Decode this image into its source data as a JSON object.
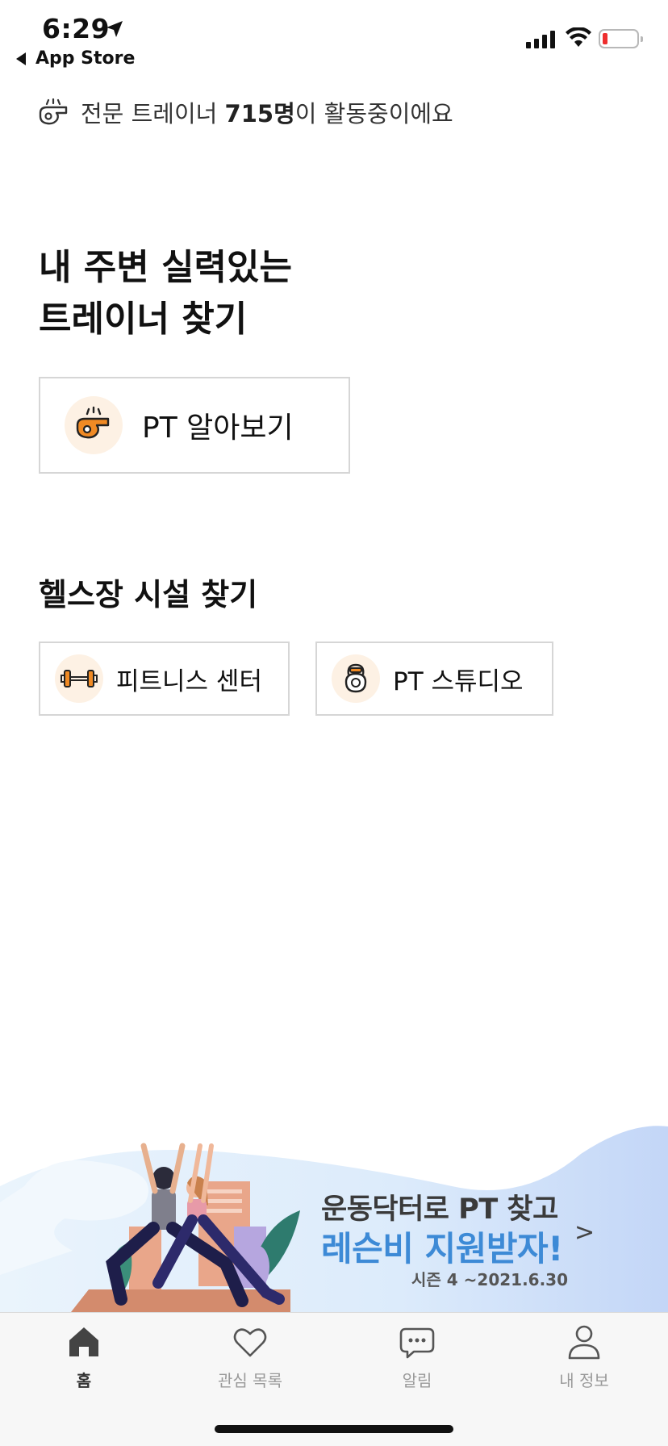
{
  "status": {
    "time": "6:29",
    "back_label": "App Store"
  },
  "trainer_count": {
    "prefix": "전문 트레이너 ",
    "count": "715명",
    "suffix": "이 활동중이에요",
    "icon": "whistle-icon"
  },
  "headline": {
    "line1": "내 주변 실력있는",
    "line2": "트레이너 찾기"
  },
  "pt_card": {
    "label": "PT 알아보기",
    "icon": "whistle-icon"
  },
  "gym_section": {
    "title": "헬스장 시설 찾기",
    "fitness_label": "피트니스 센터",
    "fitness_icon": "dumbbell-icon",
    "studio_label": "PT 스튜디오",
    "studio_icon": "kettlebell-icon"
  },
  "banner": {
    "line1": "운동닥터로 PT 찾고",
    "line2": "레슨비 지원받자!",
    "line3": "시즌 4  ~2021.6.30",
    "arrow": ">"
  },
  "tabs": [
    {
      "label": "홈",
      "icon": "home-icon",
      "active": true
    },
    {
      "label": "관심 목록",
      "icon": "heart-icon",
      "active": false
    },
    {
      "label": "알림",
      "icon": "chat-bubble-icon",
      "active": false
    },
    {
      "label": "내 정보",
      "icon": "person-icon",
      "active": false
    }
  ],
  "colors": {
    "accent_orange": "#f08a24",
    "icon_bg": "#fdf1e4",
    "banner_blue": "#3d8ad6"
  }
}
